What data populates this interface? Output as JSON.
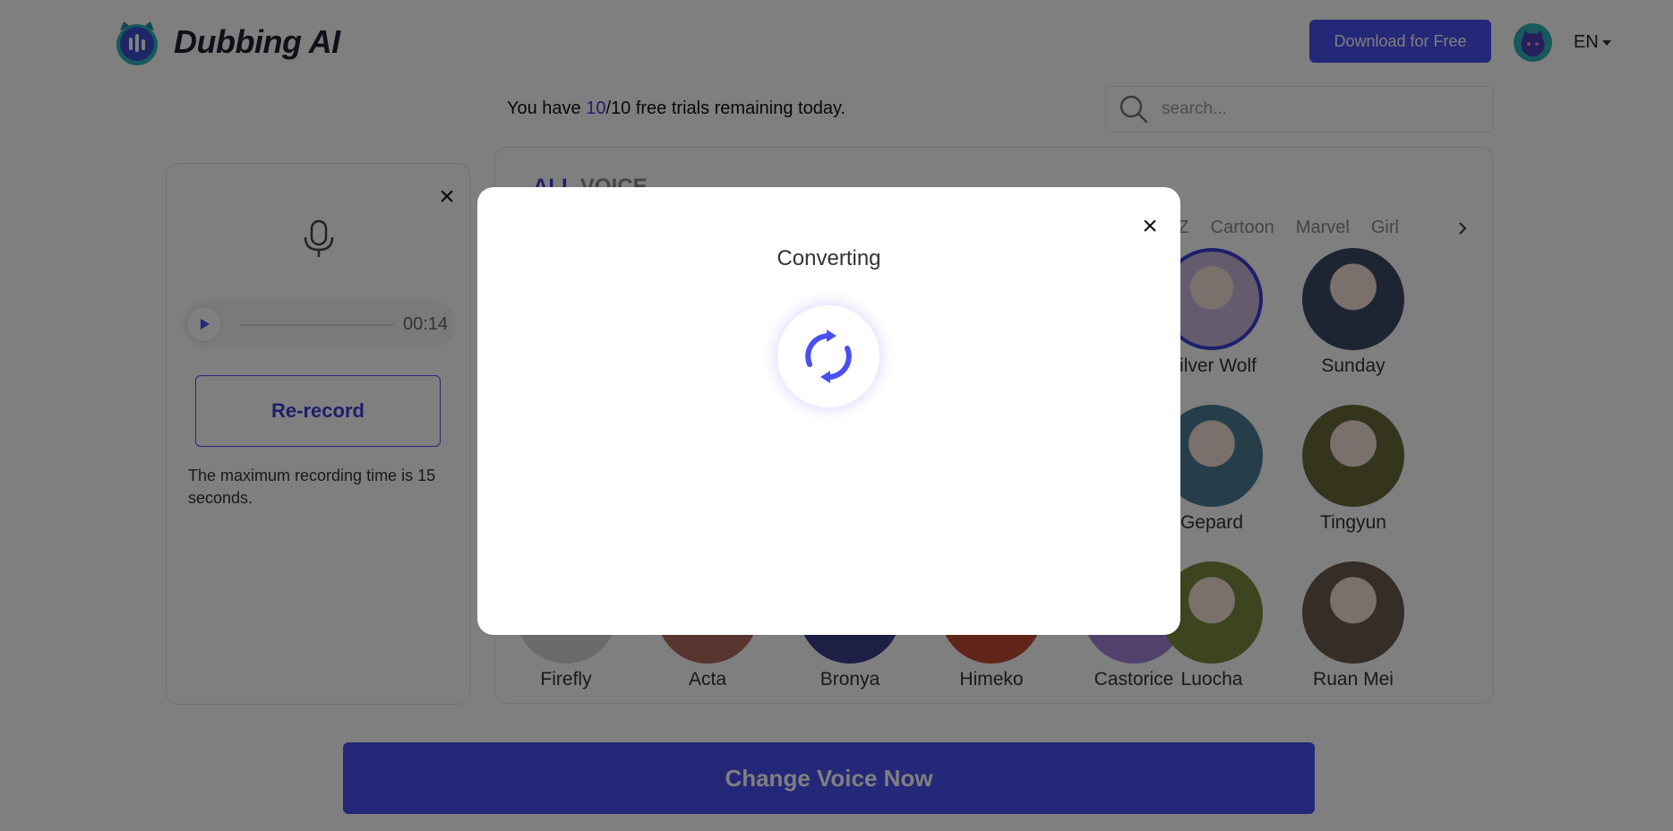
{
  "header": {
    "brand": "Dubbing AI",
    "download_label": "Download for Free",
    "language": "EN"
  },
  "trial": {
    "prefix": "You have ",
    "remaining": "10",
    "suffix": "/10 free trials remaining today."
  },
  "search": {
    "placeholder": "search..."
  },
  "recorder": {
    "duration": "00:14",
    "rerecord_label": "Re-record",
    "note": "The maximum recording time is 15 seconds."
  },
  "voices": {
    "heading_highlight": "ALL",
    "heading_rest": " VOICE",
    "categories": [
      "ZZZ",
      "Cartoon",
      "Marvel",
      "Girl"
    ],
    "items": [
      {
        "name": "Silver Wolf",
        "selected": true,
        "color": "#c9b8d8"
      },
      {
        "name": "Sunday",
        "selected": false,
        "color": "#3b4a66"
      },
      {
        "name": "Gepard",
        "selected": false,
        "color": "#4d7b95"
      },
      {
        "name": "Tingyun",
        "selected": false,
        "color": "#6b6a3c"
      },
      {
        "name": "Firefly",
        "selected": false,
        "color": "#d9d3d6"
      },
      {
        "name": "Acta",
        "selected": false,
        "color": "#b06a5e"
      },
      {
        "name": "Bronya",
        "selected": false,
        "color": "#3a3f8a"
      },
      {
        "name": "Himeko",
        "selected": false,
        "color": "#c44a33"
      },
      {
        "name": "Castorice",
        "selected": false,
        "color": "#a485d6"
      },
      {
        "name": "Luocha",
        "selected": false,
        "color": "#7a8a3c"
      },
      {
        "name": "Ruan Mei",
        "selected": false,
        "color": "#6a5b4e"
      }
    ]
  },
  "cta_label": "Change Voice Now",
  "modal": {
    "title": "Converting"
  },
  "colors": {
    "accent": "#4a4ff0",
    "accent_text": "#3b3fd6"
  }
}
